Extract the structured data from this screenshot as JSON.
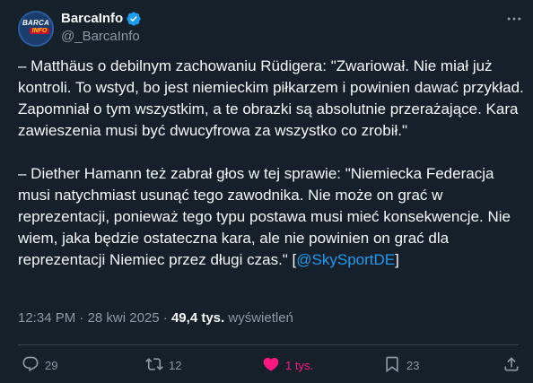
{
  "author": {
    "name": "BarcaInfo",
    "handle": "@_BarcaInfo",
    "avatar_text_top": "BARCA",
    "avatar_text_bottom": "INFO"
  },
  "tweet": {
    "paragraph1": "– Matthäus o debilnym zachowaniu Rüdigera: \"Zwariował. Nie miał już kontroli. To wstyd, bo jest niemieckim piłkarzem i powinien dawać przykład. Zapomniał o tym wszystkim, a te obrazki są absolutnie przerażające. Kara zawieszenia musi być dwucyfrowa za wszystko co zrobił.\"",
    "paragraph2_text": "– Diether Hamann też zabrał głos w tej sprawie: \"Niemiecka Federacja musi natychmiast usunąć tego zawodnika. Nie może on grać w reprezentacji, ponieważ tego typu postawa musi mieć konsekwencje. Nie wiem, jaka będzie ostateczna kara, ale nie powinien on grać dla reprezentacji Niemiec przez długi czas.\" [",
    "paragraph2_link": "@SkySportDE",
    "paragraph2_end": "]"
  },
  "meta": {
    "time": "12:34 PM",
    "separator": " · ",
    "date": "28 kwi 2025",
    "views_count": "49,4 tys.",
    "views_label": " wyświetleń"
  },
  "actions": {
    "replies": "29",
    "reposts": "12",
    "likes": "1 tys.",
    "bookmarks": "23"
  },
  "colors": {
    "background": "#15202b",
    "accent": "#1d9bf0",
    "like": "#f91880",
    "secondary_text": "#8b98a5"
  },
  "icons": [
    "verified-badge-icon",
    "more-options-icon",
    "reply-icon",
    "repost-icon",
    "like-icon",
    "bookmark-icon",
    "share-icon"
  ]
}
